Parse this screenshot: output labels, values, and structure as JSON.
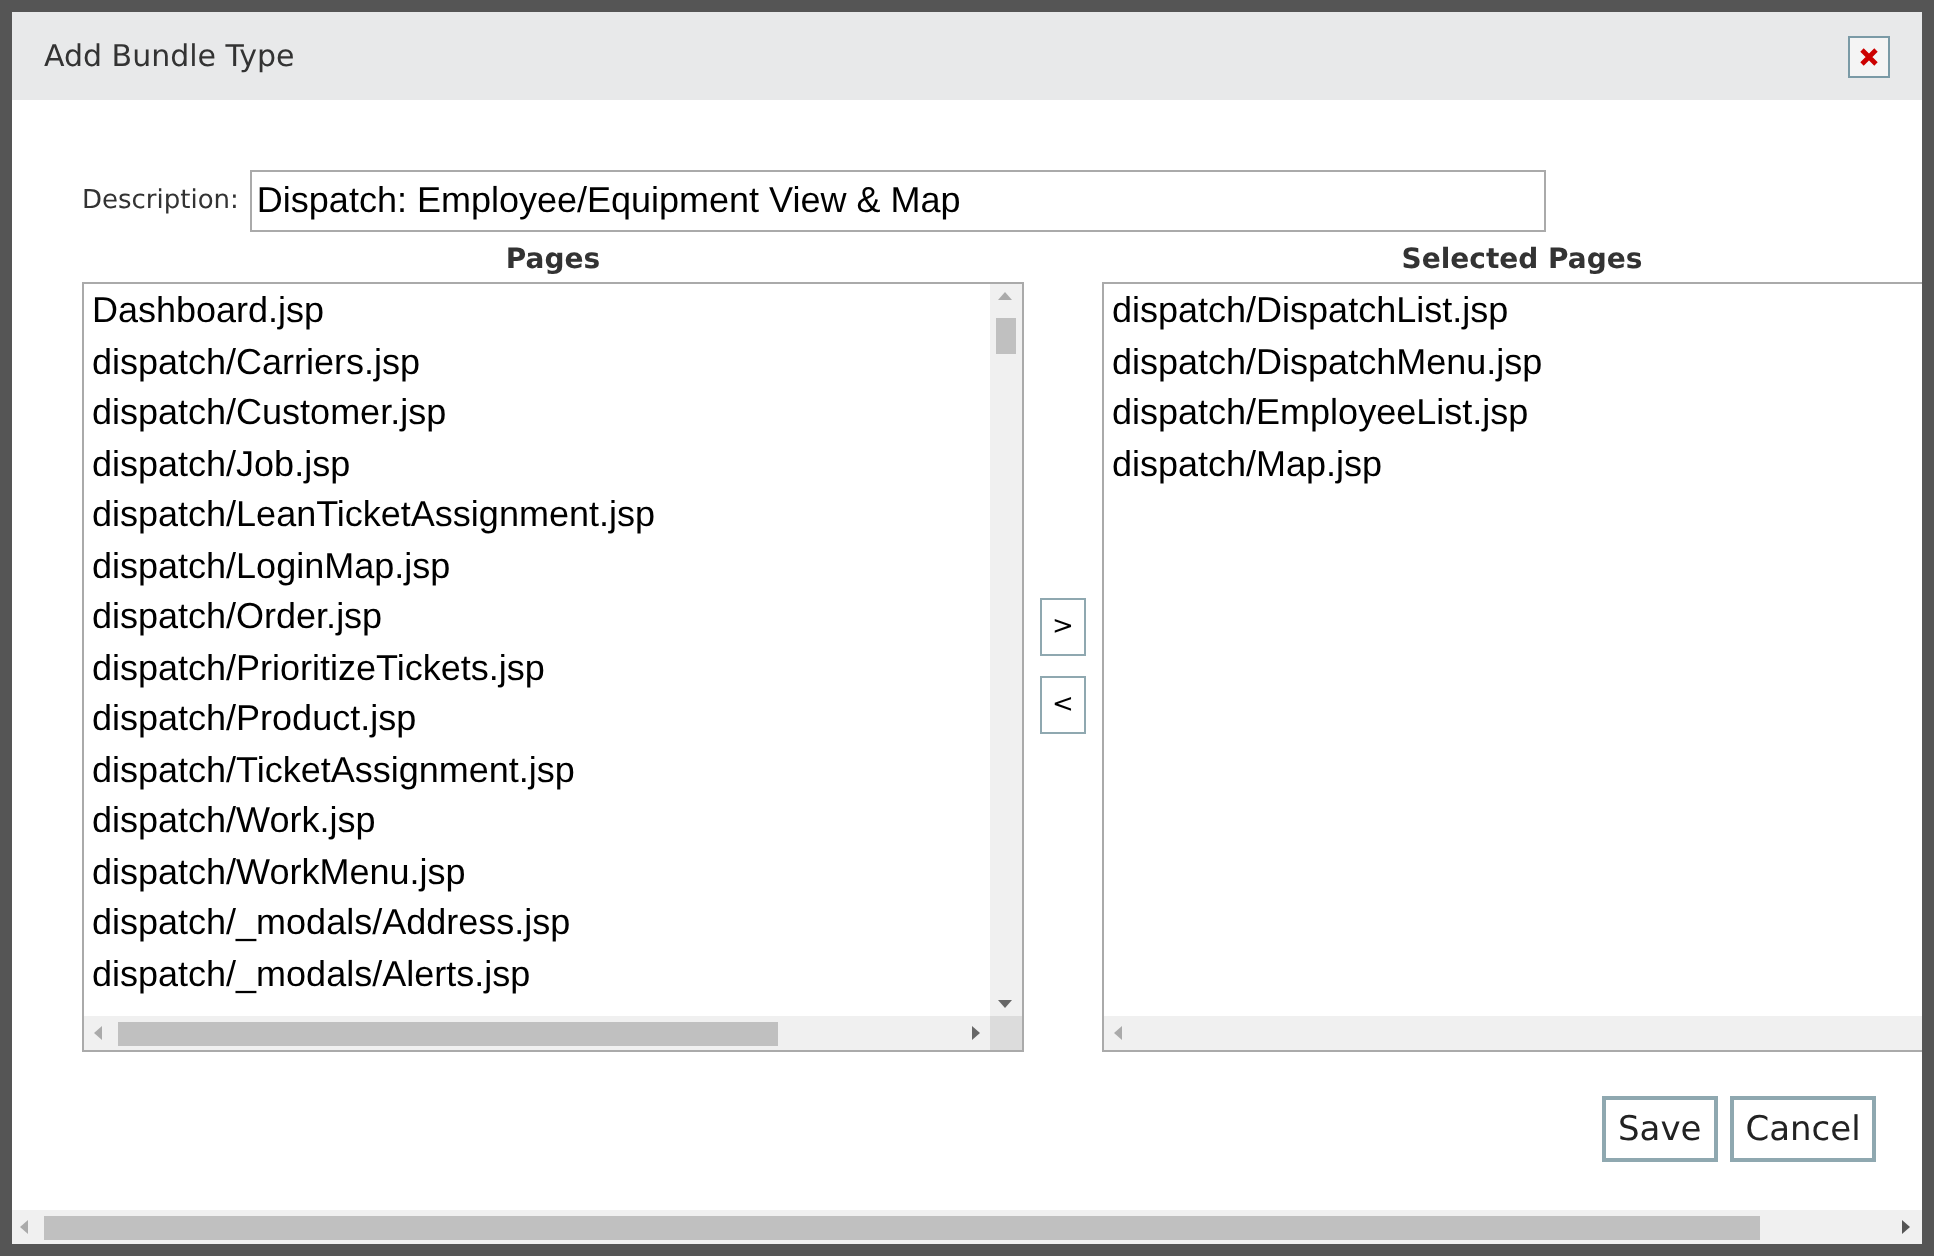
{
  "window": {
    "title": "Add Bundle Type"
  },
  "description": {
    "label": "Description:",
    "value": "Dispatch: Employee/Equipment View & Map"
  },
  "pages": {
    "heading": "Pages",
    "items": [
      {
        "label": "Dashboard.jsp",
        "selected": false
      },
      {
        "label": "dispatch/Carriers.jsp",
        "selected": false
      },
      {
        "label": "dispatch/Customer.jsp",
        "selected": false
      },
      {
        "label": "dispatch/Job.jsp",
        "selected": false
      },
      {
        "label": "dispatch/LeanTicketAssignment.jsp",
        "selected": false
      },
      {
        "label": "dispatch/LoginMap.jsp",
        "selected": false
      },
      {
        "label": "dispatch/Order.jsp",
        "selected": false
      },
      {
        "label": "dispatch/PrioritizeTickets.jsp",
        "selected": false
      },
      {
        "label": "dispatch/Product.jsp",
        "selected": false
      },
      {
        "label": "dispatch/TicketAssignment.jsp",
        "selected": false
      },
      {
        "label": "dispatch/Work.jsp",
        "selected": false
      },
      {
        "label": "dispatch/WorkMenu.jsp",
        "selected": false
      },
      {
        "label": "dispatch/_modals/Address.jsp",
        "selected": false
      },
      {
        "label": "dispatch/_modals/Alerts.jsp",
        "selected": false
      }
    ]
  },
  "move_buttons": [
    ">",
    "<"
  ],
  "selected_pages": {
    "heading": "Selected Pages",
    "items": [
      {
        "label": "dispatch/DispatchList.jsp",
        "selected": false
      },
      {
        "label": "dispatch/DispatchMenu.jsp",
        "selected": false
      },
      {
        "label": "dispatch/EmployeeList.jsp",
        "selected": false
      },
      {
        "label": "dispatch/Map.jsp",
        "selected": false
      }
    ]
  },
  "buttons": [
    "Save",
    "Cancel"
  ]
}
